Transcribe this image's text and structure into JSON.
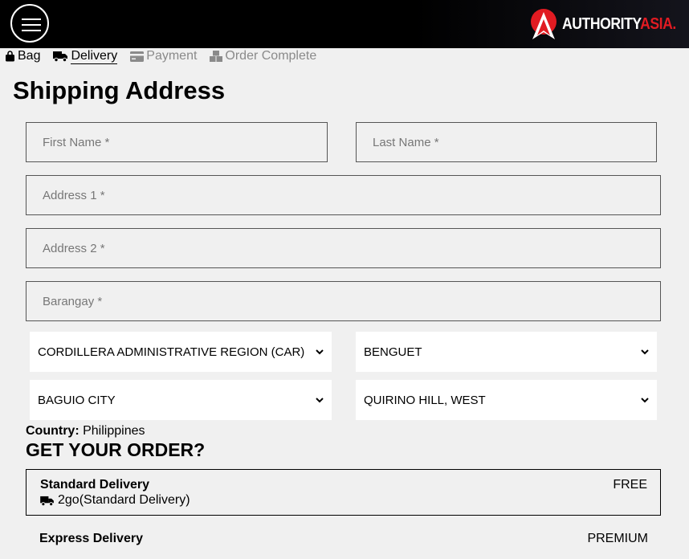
{
  "header": {
    "menu_icon": "hamburger-menu-icon",
    "logo_primary": "AUTHORITY",
    "logo_accent": "ASIA.",
    "brand_color": "#e11b22"
  },
  "steps": [
    {
      "label": "Bag",
      "icon": "shopping-bag-icon",
      "state": "done"
    },
    {
      "label": "Delivery",
      "icon": "truck-icon",
      "state": "active"
    },
    {
      "label": "Payment",
      "icon": "credit-card-icon",
      "state": "pending"
    },
    {
      "label": "Order Complete",
      "icon": "boxes-icon",
      "state": "pending"
    }
  ],
  "form": {
    "title": "Shipping Address",
    "first_name_placeholder": "First Name *",
    "last_name_placeholder": "Last Name *",
    "address1_placeholder": "Address 1 *",
    "address2_placeholder": "Address 2 *",
    "barangay_placeholder": "Barangay *",
    "region": "CORDILLERA ADMINISTRATIVE REGION (CAR)",
    "province": "BENGUET",
    "city": "BAGUIO CITY",
    "district": "QUIRINO HILL, WEST",
    "country_label": "Country:",
    "country_value": "Philippines"
  },
  "delivery": {
    "heading": "GET YOUR ORDER?",
    "options": [
      {
        "name": "Standard Delivery",
        "sub": "2go(Standard Delivery)",
        "price": "FREE"
      },
      {
        "name": "Express Delivery",
        "price": "PREMIUM"
      }
    ]
  }
}
